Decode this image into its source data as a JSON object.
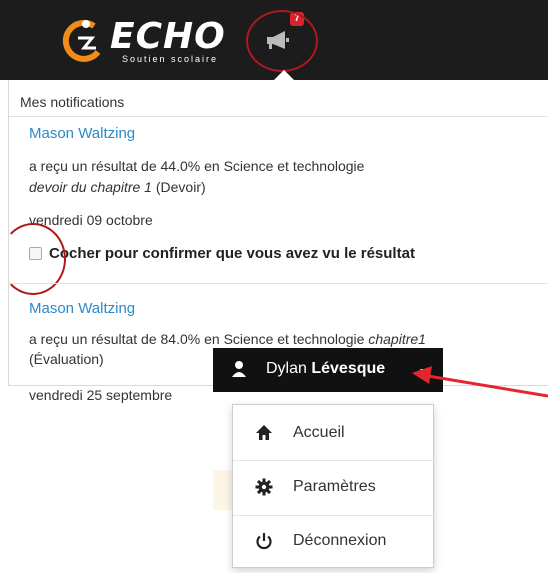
{
  "header": {
    "logo_word": "ECHO",
    "logo_sub": "Soutien scolaire",
    "notification_count": "7",
    "colors": {
      "bar": "#1c1c1c",
      "badge": "#d9232d",
      "annotation": "#b0181f"
    }
  },
  "notifications": {
    "title": "Mes notifications",
    "items": [
      {
        "student": "Mason Waltzing",
        "line1": "a reçu un résultat de 44.0% en Science et technologie",
        "assignment_italic": "devoir du chapitre 1",
        "assignment_type": " (Devoir)",
        "date": "vendredi 09 octobre",
        "confirm_label": "Cocher pour confirmer que vous avez vu le résultat"
      },
      {
        "student": "Mason Waltzing",
        "line1": "a reçu un résultat de 84.0% en Science et technologie ",
        "assignment_italic": "chapitre1",
        "assignment_type": "(Évaluation)",
        "date": "vendredi 25 septembre"
      }
    ]
  },
  "user_menu": {
    "first_name": "Dylan ",
    "last_name": "Lévesque",
    "items": [
      {
        "label": "Accueil",
        "icon": "home-icon"
      },
      {
        "label": "Paramètres",
        "icon": "gear-icon"
      },
      {
        "label": "Déconnexion",
        "icon": "power-icon"
      }
    ]
  }
}
